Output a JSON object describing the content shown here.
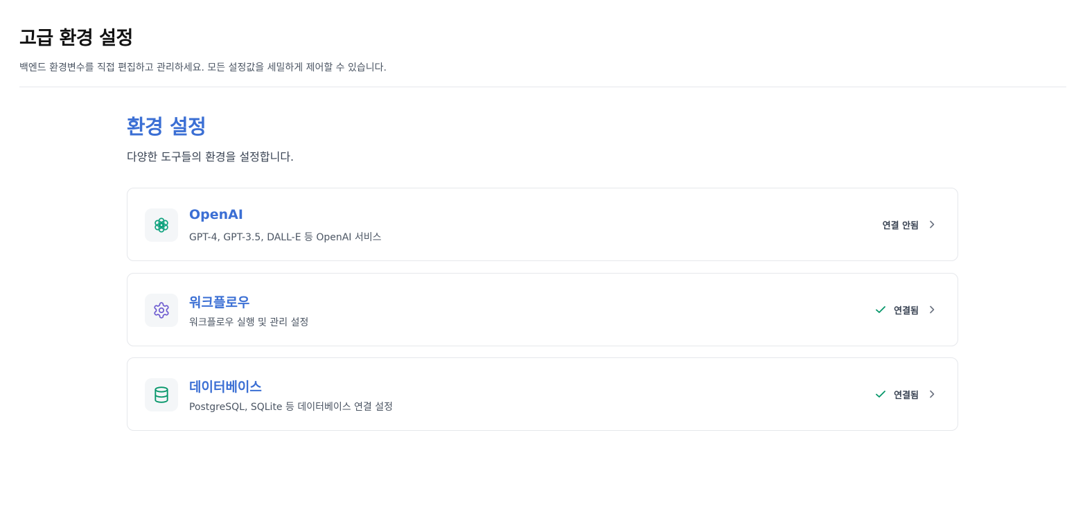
{
  "header": {
    "title": "고급 환경 설정",
    "description": "백엔드 환경변수를 직접 편집하고 관리하세요. 모든 설정값을 세밀하게 제어할 수 있습니다."
  },
  "section": {
    "title": "환경 설정",
    "description": "다양한 도구들의 환경을 설정합니다."
  },
  "cards": [
    {
      "name": "OpenAI",
      "description": "GPT-4, GPT-3.5, DALL-E 등 OpenAI 서비스",
      "icon": "openai-icon",
      "status": "연결 안됨",
      "connected": false
    },
    {
      "name": "워크플로우",
      "description": "워크플로우 실행 및 관리 설정",
      "icon": "gear-icon",
      "status": "연결됨",
      "connected": true
    },
    {
      "name": "데이터베이스",
      "description": "PostgreSQL, SQLite 등 데이터베이스 연결 설정",
      "icon": "database-icon",
      "status": "연결됨",
      "connected": true
    }
  ],
  "colors": {
    "accent": "#3b6fd4",
    "openai_icon": "#10a37f",
    "gear_icon": "#6d5bd0",
    "database_icon": "#059669",
    "check": "#059669"
  }
}
